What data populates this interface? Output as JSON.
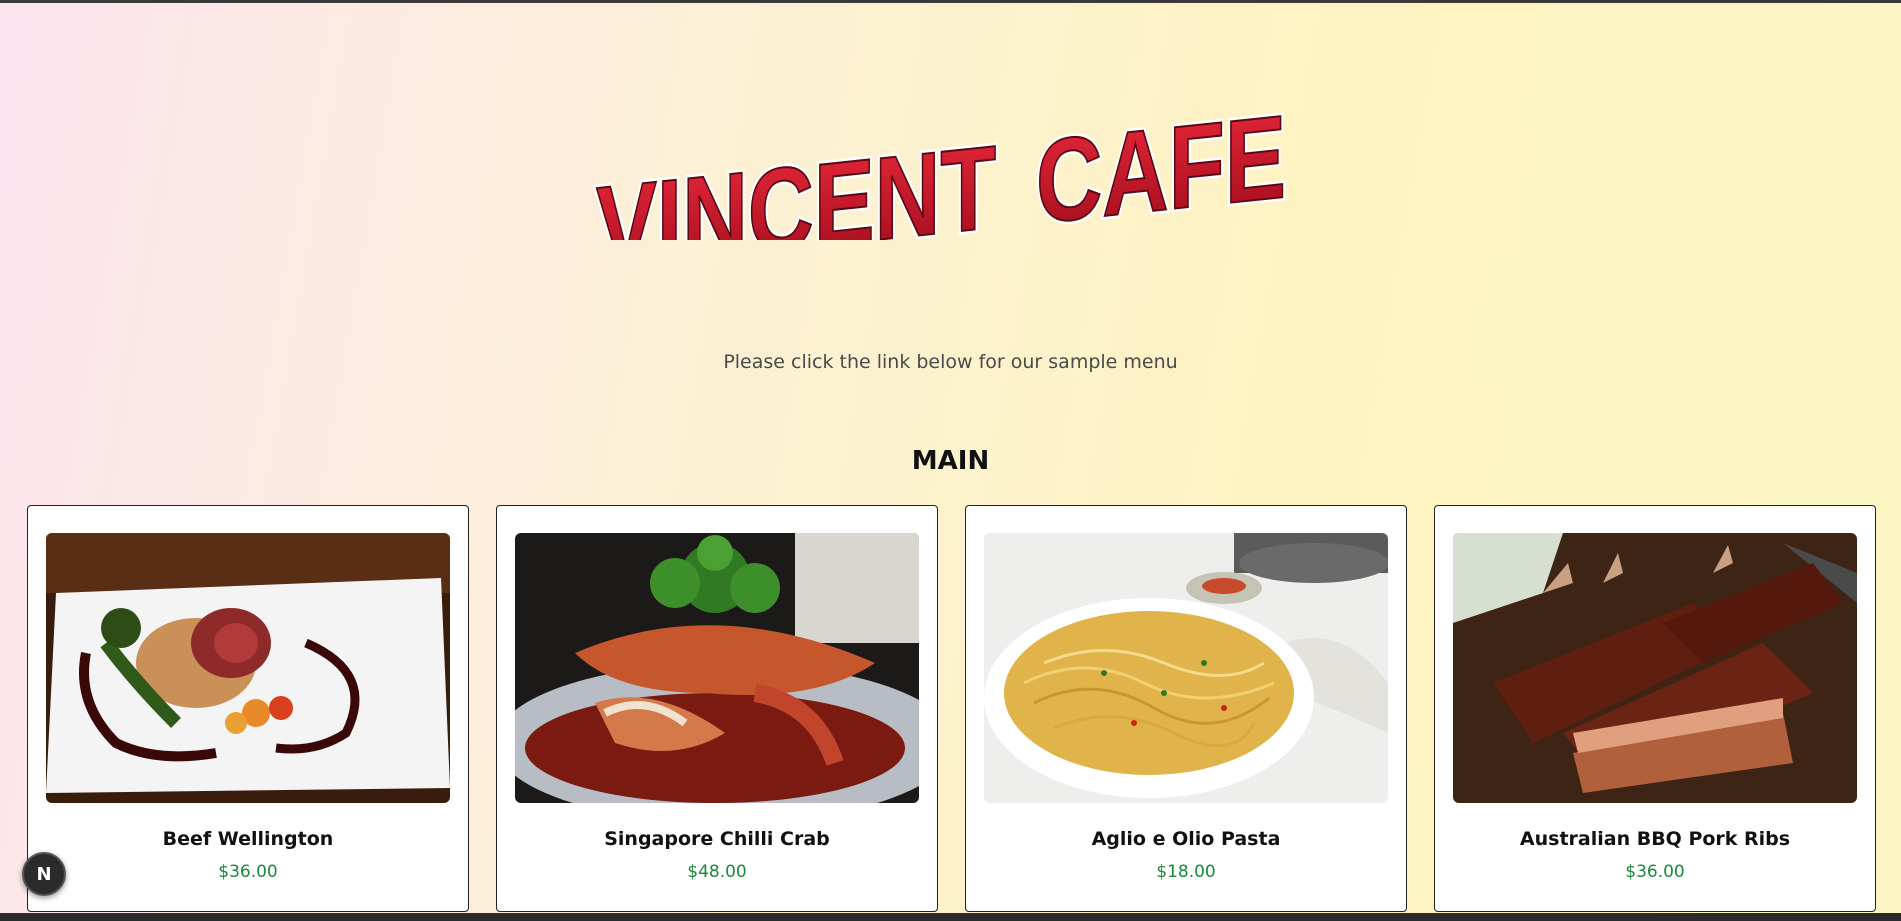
{
  "brand": {
    "title": "VINCENT CAFE",
    "word1": "VINCENT",
    "word2": "CAFE"
  },
  "intro": {
    "text": "Please click the link below for our sample menu"
  },
  "section": {
    "title": "MAIN"
  },
  "menu": [
    {
      "name": "Beef Wellington",
      "price": "$36.00",
      "image": "beef-wellington-photo"
    },
    {
      "name": "Singapore Chilli Crab",
      "price": "$48.00",
      "image": "chilli-crab-photo"
    },
    {
      "name": "Aglio e Olio Pasta",
      "price": "$18.00",
      "image": "aglio-olio-pasta-photo"
    },
    {
      "name": "Australian BBQ Pork Ribs",
      "price": "$36.00",
      "image": "bbq-pork-ribs-photo"
    }
  ],
  "dev_badge": {
    "label": "N"
  },
  "colors": {
    "price": "#198a3a",
    "logo_red": "#c8102e",
    "card_border": "#222222"
  }
}
